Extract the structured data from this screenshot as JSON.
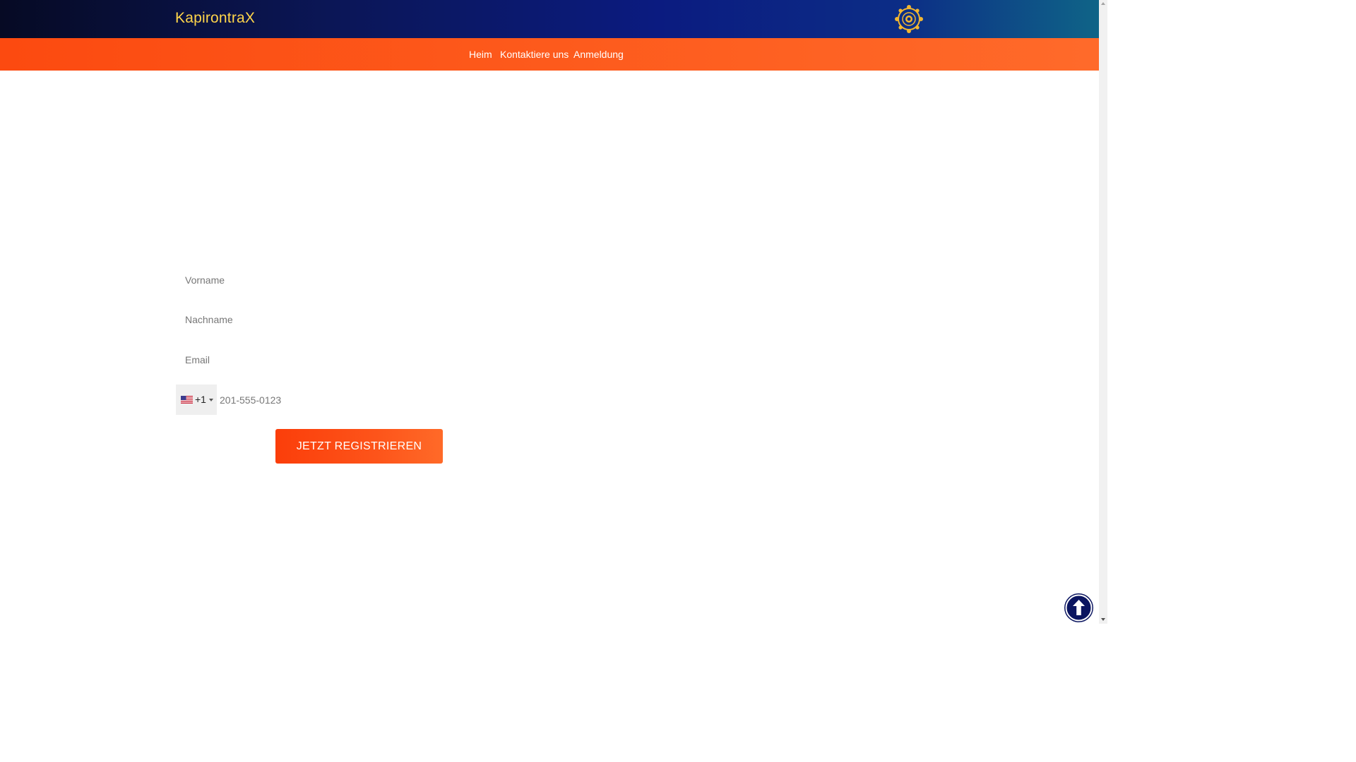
{
  "header": {
    "brand": "KapirontraX",
    "logo_icon": "sun-emblem-icon",
    "colors": {
      "brand_text": "#ffd54a",
      "bar_dark": "#060a24",
      "bar_blue": "#0b1b80"
    }
  },
  "nav": {
    "items": [
      {
        "label": "Heim"
      },
      {
        "label": "Kontaktiere uns"
      },
      {
        "label": "Anmeldung"
      }
    ],
    "color": "#fd5a1c"
  },
  "form": {
    "first_name": {
      "placeholder": "Vorname",
      "value": ""
    },
    "last_name": {
      "placeholder": "Nachname",
      "value": ""
    },
    "email": {
      "placeholder": "Email",
      "value": ""
    },
    "phone": {
      "country_flag": "us-flag-icon",
      "dial_code": "+1",
      "placeholder": "201-555-0123",
      "value": ""
    },
    "submit_label": "JETZT REGISTRIEREN",
    "accent": "#fb3e0a"
  },
  "scroll_top": {
    "icon": "arrow-up-icon",
    "color": "#0b1560"
  }
}
